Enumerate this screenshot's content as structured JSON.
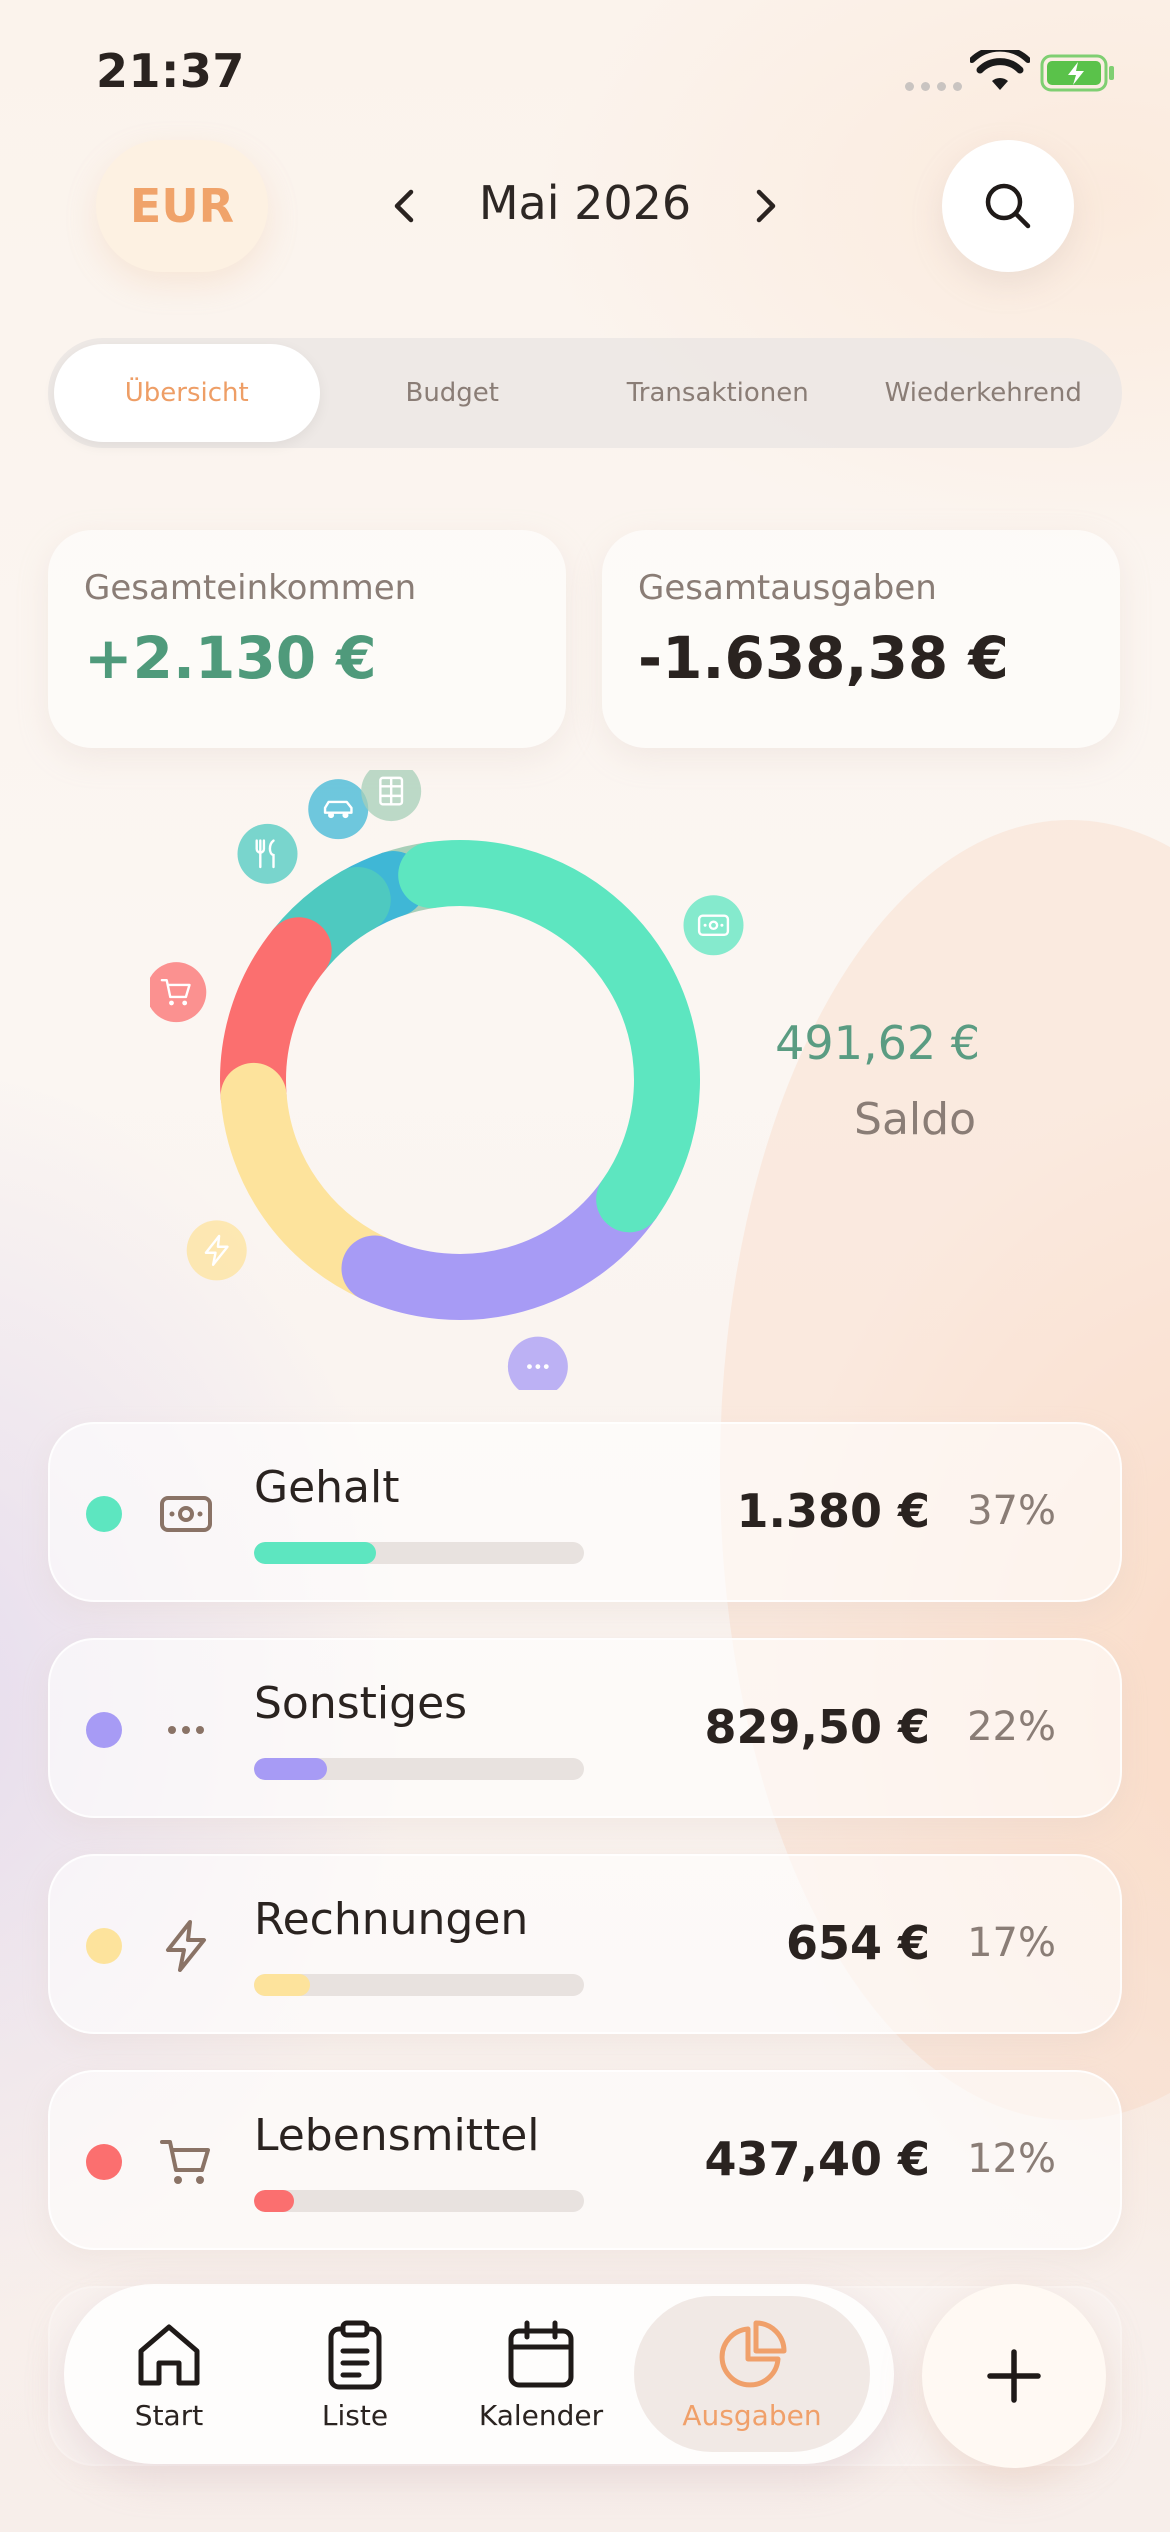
{
  "status_bar": {
    "time": "21:37"
  },
  "header": {
    "currency": "EUR",
    "month": "Mai 2026"
  },
  "tabs": [
    {
      "label": "Übersicht",
      "active": true
    },
    {
      "label": "Budget",
      "active": false
    },
    {
      "label": "Transaktionen",
      "active": false
    },
    {
      "label": "Wiederkehrend",
      "active": false
    }
  ],
  "summary": {
    "income_label": "Gesamteinkommen",
    "income_value": "+2.130 €",
    "expense_label": "Gesamtausgaben",
    "expense_value": "-1.638,38 €"
  },
  "balance": {
    "value": "491,62 €",
    "label": "Saldo"
  },
  "chart_data": {
    "type": "pie",
    "variant": "donut",
    "slices": [
      {
        "name": "Gehalt",
        "percent": 37,
        "color": "#5de6c0",
        "icon": "cash-icon"
      },
      {
        "name": "Sonstiges",
        "percent": 22,
        "color": "#a79bf5",
        "icon": "more-icon"
      },
      {
        "name": "Rechnungen",
        "percent": 17,
        "color": "#fde39c",
        "icon": "bolt-icon"
      },
      {
        "name": "Lebensmittel",
        "percent": 12,
        "color": "#fb6f6f",
        "icon": "cart-icon"
      },
      {
        "name": "Essen",
        "percent": 6,
        "color": "#4ec9c0",
        "icon": "cutlery-icon"
      },
      {
        "name": "Transport",
        "percent": 3,
        "color": "#3fb7d6",
        "icon": "car-icon"
      },
      {
        "name": "Unterhaltung",
        "percent": 3,
        "color": "#a7cfb8",
        "icon": "film-icon"
      }
    ]
  },
  "categories": [
    {
      "name": "Gehalt",
      "amount": "1.380 €",
      "percent": "37%",
      "fill": 0.37,
      "color": "#5de6c0",
      "icon": "cash-icon"
    },
    {
      "name": "Sonstiges",
      "amount": "829,50 €",
      "percent": "22%",
      "fill": 0.22,
      "color": "#a79bf5",
      "icon": "more-icon"
    },
    {
      "name": "Rechnungen",
      "amount": "654 €",
      "percent": "17%",
      "fill": 0.17,
      "color": "#fde39c",
      "icon": "bolt-icon"
    },
    {
      "name": "Lebensmittel",
      "amount": "437,40 €",
      "percent": "12%",
      "fill": 0.12,
      "color": "#fb6f6f",
      "icon": "cart-icon"
    }
  ],
  "nav": {
    "items": [
      {
        "label": "Start",
        "icon": "home-icon"
      },
      {
        "label": "Liste",
        "icon": "clipboard-icon"
      },
      {
        "label": "Kalender",
        "icon": "calendar-icon"
      },
      {
        "label": "Ausgaben",
        "icon": "pie-chart-icon",
        "active": true
      }
    ],
    "add_icon": "plus-icon"
  }
}
